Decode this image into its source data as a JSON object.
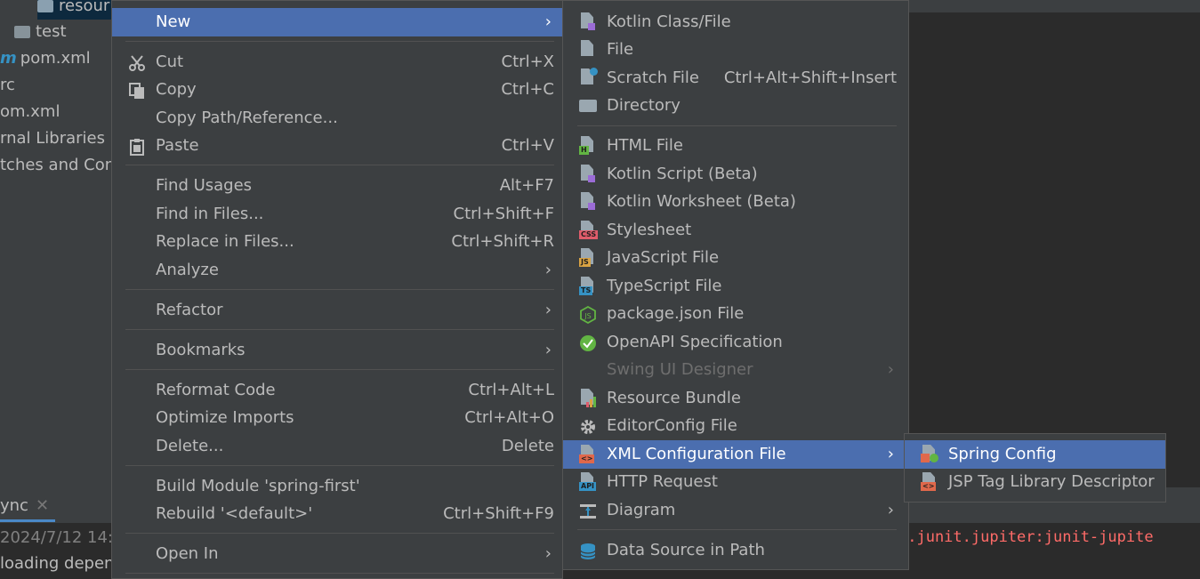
{
  "project_tree": {
    "items": [
      {
        "label": "resour",
        "kind": "folder"
      },
      {
        "label": "test",
        "kind": "folder"
      },
      {
        "label": "pom.xml",
        "kind": "maven"
      },
      {
        "label": "rc",
        "kind": "file"
      },
      {
        "label": "om.xml",
        "kind": "file"
      },
      {
        "label": "rnal Libraries",
        "kind": "lib"
      },
      {
        "label": "tches and Cons",
        "kind": "scratch"
      }
    ]
  },
  "bottom_panel": {
    "tab_label": "ync",
    "timestamp": "2024/7/12 14:",
    "loading": "loading depen",
    "error_text": "g.junit.jupiter:junit-jupite"
  },
  "context_menu": {
    "items": [
      {
        "label": "New",
        "arrow": "›"
      },
      {
        "label": "Cut",
        "shortcut": "Ctrl+X",
        "icon": "scissors-icon"
      },
      {
        "label": "Copy",
        "shortcut": "Ctrl+C",
        "icon": "copy-icon"
      },
      {
        "label": "Copy Path/Reference..."
      },
      {
        "label": "Paste",
        "shortcut": "Ctrl+V",
        "icon": "paste-icon"
      },
      {
        "label": "Find Usages",
        "shortcut": "Alt+F7"
      },
      {
        "label": "Find in Files...",
        "shortcut": "Ctrl+Shift+F"
      },
      {
        "label": "Replace in Files...",
        "shortcut": "Ctrl+Shift+R"
      },
      {
        "label": "Analyze",
        "arrow": "›"
      },
      {
        "label": "Refactor",
        "arrow": "›"
      },
      {
        "label": "Bookmarks",
        "arrow": "›"
      },
      {
        "label": "Reformat Code",
        "shortcut": "Ctrl+Alt+L"
      },
      {
        "label": "Optimize Imports",
        "shortcut": "Ctrl+Alt+O"
      },
      {
        "label": "Delete...",
        "shortcut": "Delete"
      },
      {
        "label": "Build Module 'spring-first'"
      },
      {
        "label": "Rebuild '<default>'",
        "shortcut": "Ctrl+Shift+F9"
      },
      {
        "label": "Open In",
        "arrow": "›"
      }
    ]
  },
  "new_menu": {
    "items": [
      {
        "label": "Kotlin Class/File",
        "icon": "kotlin-class-icon"
      },
      {
        "label": "File",
        "icon": "file-icon"
      },
      {
        "label": "Scratch File",
        "shortcut": "Ctrl+Alt+Shift+Insert",
        "icon": "scratch-file-icon"
      },
      {
        "label": "Directory",
        "icon": "folder-icon"
      },
      {
        "label": "HTML File",
        "icon": "html-file-icon",
        "tag": "H"
      },
      {
        "label": "Kotlin Script (Beta)",
        "icon": "kotlin-script-icon"
      },
      {
        "label": "Kotlin Worksheet (Beta)",
        "icon": "kotlin-worksheet-icon"
      },
      {
        "label": "Stylesheet",
        "icon": "css-file-icon",
        "tag": "CSS"
      },
      {
        "label": "JavaScript File",
        "icon": "js-file-icon",
        "tag": "JS"
      },
      {
        "label": "TypeScript File",
        "icon": "ts-file-icon",
        "tag": "TS"
      },
      {
        "label": "package.json File",
        "icon": "nodejs-icon"
      },
      {
        "label": "OpenAPI Specification",
        "icon": "openapi-icon"
      },
      {
        "label": "Swing UI Designer",
        "arrow": "›"
      },
      {
        "label": "Resource Bundle",
        "icon": "resource-bundle-icon"
      },
      {
        "label": "EditorConfig File",
        "icon": "gear-icon"
      },
      {
        "label": "XML Configuration File",
        "arrow": "›",
        "icon": "xml-file-icon",
        "tag": "<>"
      },
      {
        "label": "HTTP Request",
        "icon": "http-request-icon",
        "tag": "API"
      },
      {
        "label": "Diagram",
        "arrow": "›",
        "icon": "diagram-icon"
      },
      {
        "label": "Data Source in Path",
        "icon": "database-icon"
      }
    ]
  },
  "xml_menu": {
    "items": [
      {
        "label": "Spring Config",
        "icon": "spring-config-icon"
      },
      {
        "label": "JSP Tag Library Descriptor",
        "icon": "jsp-tld-icon",
        "tag": "<>"
      }
    ]
  },
  "colors": {
    "menu_bg": "#3c3f41",
    "selection": "#4b6eaf",
    "text": "#bbbbbb",
    "disabled": "#6e6e6e",
    "error": "#ff6b68"
  }
}
